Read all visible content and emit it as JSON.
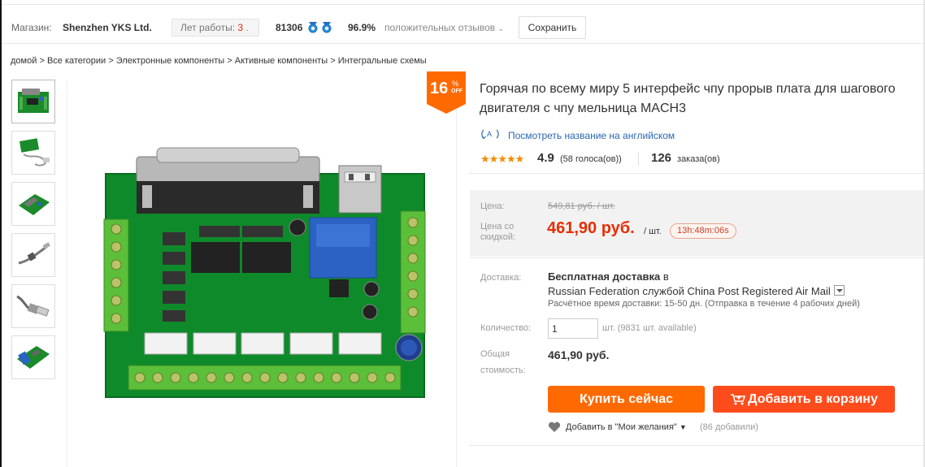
{
  "store": {
    "label": "Магазин:",
    "name": "Shenzhen YKS Ltd.",
    "years_label": "Лет работы:",
    "years_value": "3",
    "feedback_score": "81306",
    "positive_pct": "96.9%",
    "positive_label": "положительных отзывов",
    "save_label": "Сохранить"
  },
  "breadcrumb": [
    "домой",
    "Все категории",
    "Электронные компоненты",
    "Активные компоненты",
    "Интегральные схемы"
  ],
  "discount": {
    "value": "16",
    "sign": "%",
    "off": "OFF"
  },
  "product": {
    "title_line1": "Горячая по всему миру 5 интерфейс чпу прорыв плата для шагового",
    "title_line2": "двигателя с чпу мельница MACH3",
    "translate_label": "Посмотреть название на английском",
    "rating": "4.9",
    "votes": "(58 голоса(ов))",
    "orders": "126",
    "orders_label": "заказа(ов)"
  },
  "price": {
    "label": "Цена:",
    "old_price": "549,81 руб. / шт.",
    "discount_label": "Цена со скидкой:",
    "new_price": "461,90 руб.",
    "unit": "/ шт.",
    "timer": "13h:48m:06s"
  },
  "delivery": {
    "label": "Доставка:",
    "title_bold": "Бесплатная доставка",
    "title_rest": " в",
    "method": "Russian Federation службой China Post Registered Air Mail",
    "time": "Расчётное время доставки: 15-50 дн. (Отправка в течение 4 рабочих дней)"
  },
  "quantity": {
    "label": "Количество:",
    "value": "1",
    "available": "шт. (9831 шт. available)"
  },
  "total": {
    "label_line1": "Общая",
    "label_line2": "стоимость:",
    "value": "461,90 руб."
  },
  "actions": {
    "buy_label": "Купить сейчас",
    "cart_label": "Добавить в корзину",
    "wishlist_label": "Добавить в \"Мои желания\"",
    "wishlist_count": "(86 добавили)"
  },
  "colors": {
    "accent": "#ff6a00",
    "cart": "#ff4c1c",
    "price": "#e62e04",
    "link": "#2a67b1"
  }
}
